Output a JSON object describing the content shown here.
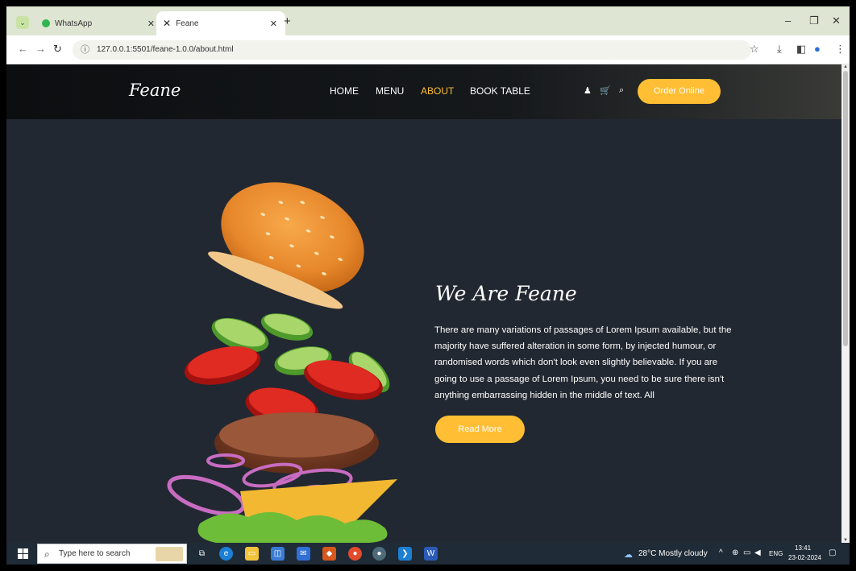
{
  "browser": {
    "tabs": [
      {
        "title": "WhatsApp"
      },
      {
        "title": "Feane"
      }
    ],
    "new_tab_symbol": "+",
    "url": "127.0.0.1:5501/feane-1.0.0/about.html"
  },
  "site": {
    "logo": "Feane",
    "nav": {
      "home": "HOME",
      "menu": "MENU",
      "about": "ABOUT",
      "book_table": "BOOK TABLE"
    },
    "order_button": "Order Online",
    "accent_color": "#ffbe33",
    "background_color": "#222831",
    "about": {
      "title": "We Are Feane",
      "text": "There are many variations of passages of Lorem Ipsum available, but the majority have suffered alteration in some form, by injected humour, or randomised words which don't look even slightly believable. If you are going to use a passage of Lorem Ipsum, you need to be sure there isn't anything embarrassing hidden in the middle of text. All",
      "button": "Read More"
    }
  },
  "taskbar": {
    "search_placeholder": "Type here to search",
    "weather": "28°C  Mostly cloudy",
    "language": "ENG",
    "time": "13:41",
    "date": "23-02-2024"
  }
}
